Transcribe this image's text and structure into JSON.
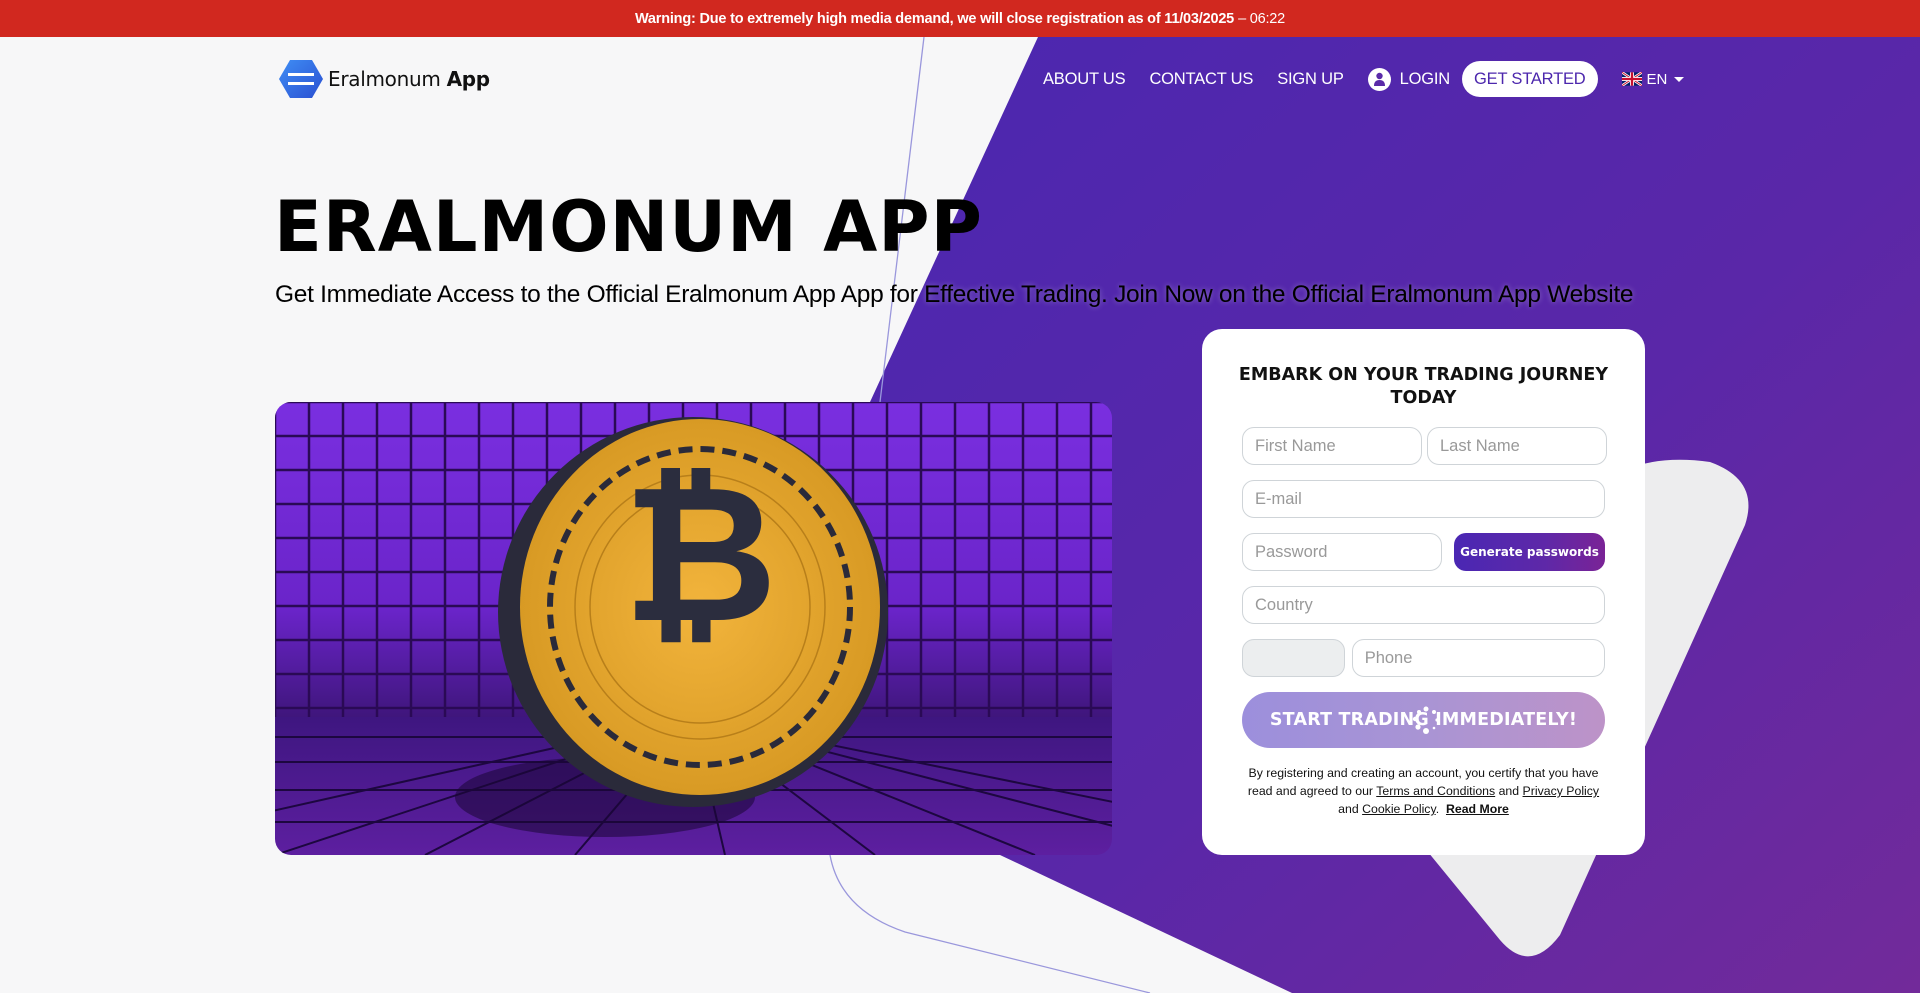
{
  "warning": {
    "text": "Warning: Due to extremely high media demand, we will close registration as of 11/03/2025",
    "time": "– 06:22"
  },
  "brand": {
    "name_regular": "Eralmonum",
    "name_bold": "App",
    "logo_icon": "hexagon-logo-icon"
  },
  "nav": {
    "about": "ABOUT US",
    "contact": "CONTACT US",
    "signup": "SIGN UP",
    "login": "LOGIN",
    "get_started": "GET STARTED",
    "language": "EN",
    "language_icon": "uk-flag-icon"
  },
  "hero": {
    "title": "ERALMONUM APP",
    "subtitle": "Get Immediate Access to the Official Eralmonum App App for Effective Trading. Join Now on the Official Eralmonum App Website",
    "image_alt": "Bitcoin coin on purple grid background"
  },
  "form": {
    "title": "EMBARK ON YOUR TRADING JOURNEY TODAY",
    "first_name_placeholder": "First Name",
    "last_name_placeholder": "Last Name",
    "email_placeholder": "E-mail",
    "password_placeholder": "Password",
    "generate_label": "Generate passwords",
    "country_placeholder": "Country",
    "country_code_value": "",
    "phone_placeholder": "Phone",
    "submit_label": "START TRADING IMMEDIATELY!",
    "legal": {
      "prefix": "By registering and creating an account, you certify that you have read and agreed to our",
      "terms": "Terms and Conditions",
      "and1": "and",
      "privacy": "Privacy Policy",
      "and2": "and",
      "cookie": "Cookie Policy",
      "period": ".",
      "read_more": "Read More"
    }
  },
  "colors": {
    "warning_bg": "#d1281f",
    "purple_primary": "#4c27ad",
    "purple_secondary": "#6b2a9e",
    "page_bg": "#f7f7f8"
  }
}
